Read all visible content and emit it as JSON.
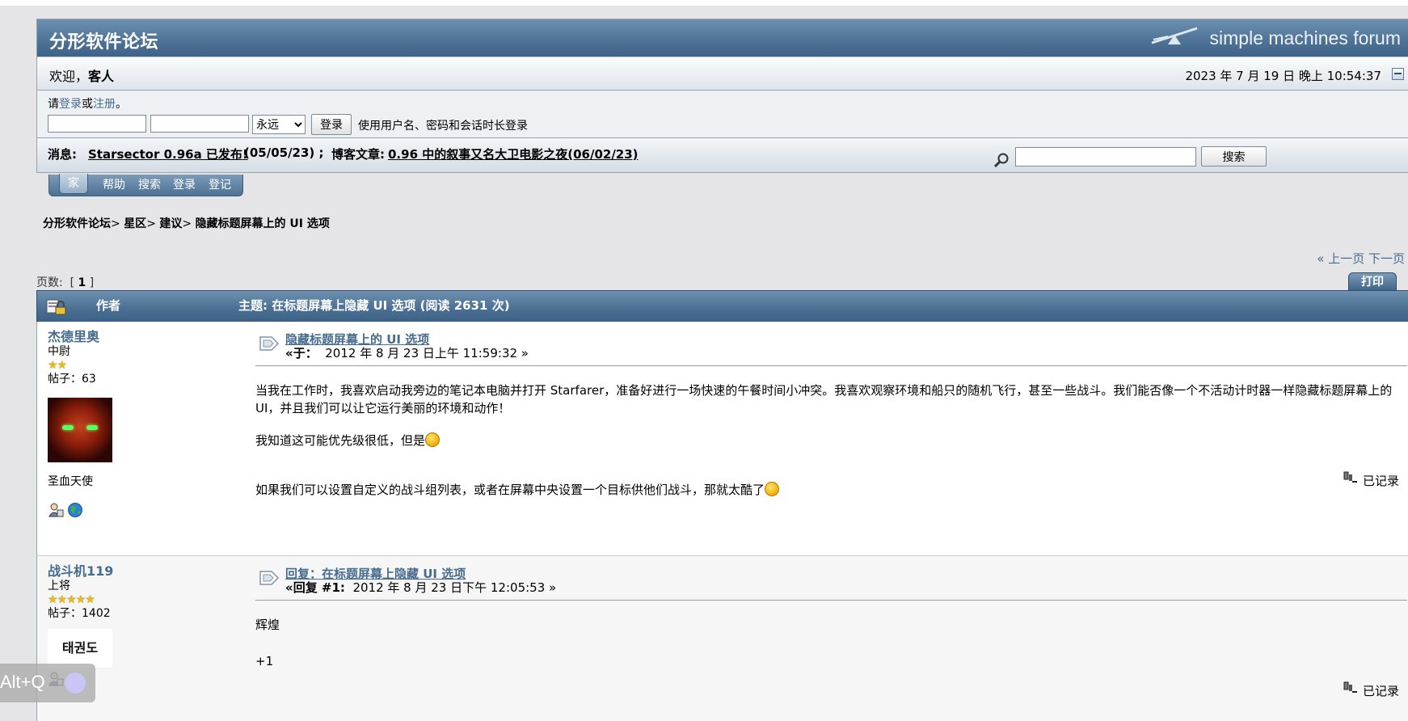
{
  "header": {
    "forum_title": "分形软件论坛",
    "brand": "simple machines forum"
  },
  "welcome": {
    "greeting": "欢迎，",
    "user": "客人",
    "datetime": "2023 年 7 月 19 日 晚上 10:54:37"
  },
  "login": {
    "prompt_pre": "请",
    "login_link": "登录",
    "or": "或",
    "register_link": "注册",
    "period": "。",
    "username_value": "",
    "password_value": "",
    "duration_selected": "永远",
    "button": "登录",
    "hint": "使用用户名、密码和会话时长登录"
  },
  "news": {
    "label": "消息:",
    "item1": "Starsector 0.96a 已发布!",
    "item1_date": "(05/05/23) ;",
    "blog_label": "博客文章:",
    "item2": "0.96 中的叙事又名大卫电影之夜(06/02/23)",
    "search_value": "",
    "search_button": "搜索"
  },
  "tabs": [
    "家",
    "帮助",
    "搜索",
    "登录",
    "登记"
  ],
  "breadcrumb": [
    "分形软件论坛",
    "星区",
    "建议",
    "隐藏标题屏幕上的 UI 选项"
  ],
  "pagenav": {
    "prev": "« 上一页",
    "next": "下一页"
  },
  "pages": {
    "label": "页数:",
    "open": "[",
    "current": "1",
    "close": "]"
  },
  "print_label": "打印",
  "thread_header": {
    "author": "作者",
    "topic": "主题: 在标题屏幕上隐藏 UI 选项 (阅读 2631 次)"
  },
  "posts": [
    {
      "name": "杰德里奥",
      "rank": "中尉",
      "stars": "★★",
      "posts": "帖子：63",
      "custom_text": "圣血天使",
      "subject": "隐藏标题屏幕上的 UI 选项",
      "when_label": "«于：",
      "when": "2012 年 8 月 23 日上午 11:59:32 »",
      "body1": "当我在工作时，我喜欢启动我旁边的笔记本电脑并打开 Starfarer，准备好进行一场快速的午餐时间小冲突。我喜欢观察环境和船只的随机飞行，甚至一些战斗。我们能否像一个不活动计时器一样隐藏标题屏幕上的 UI，并且我们可以让它运行美丽的环境和动作！",
      "body2": "我知道这可能优先级很低，但是",
      "body3": "如果我们可以设置自定义的战斗组列表，或者在屏幕中央设置一个目标供他们战斗，那就太酷了",
      "logged": "已记录"
    },
    {
      "name": "战斗机119",
      "rank": "上将",
      "stars": "★★★★★",
      "posts": "帖子：1402",
      "avatar_text": "태권도",
      "subject": "回复：在标题屏幕上隐藏 UI 选项",
      "when_label": "«回复 #1:",
      "when": "2012 年 8 月 23 日下午 12:05:53 »",
      "body1": "辉煌",
      "body2": "+1",
      "logged": "已记录"
    }
  ],
  "overlay": {
    "shortcut": "Alt+Q"
  }
}
